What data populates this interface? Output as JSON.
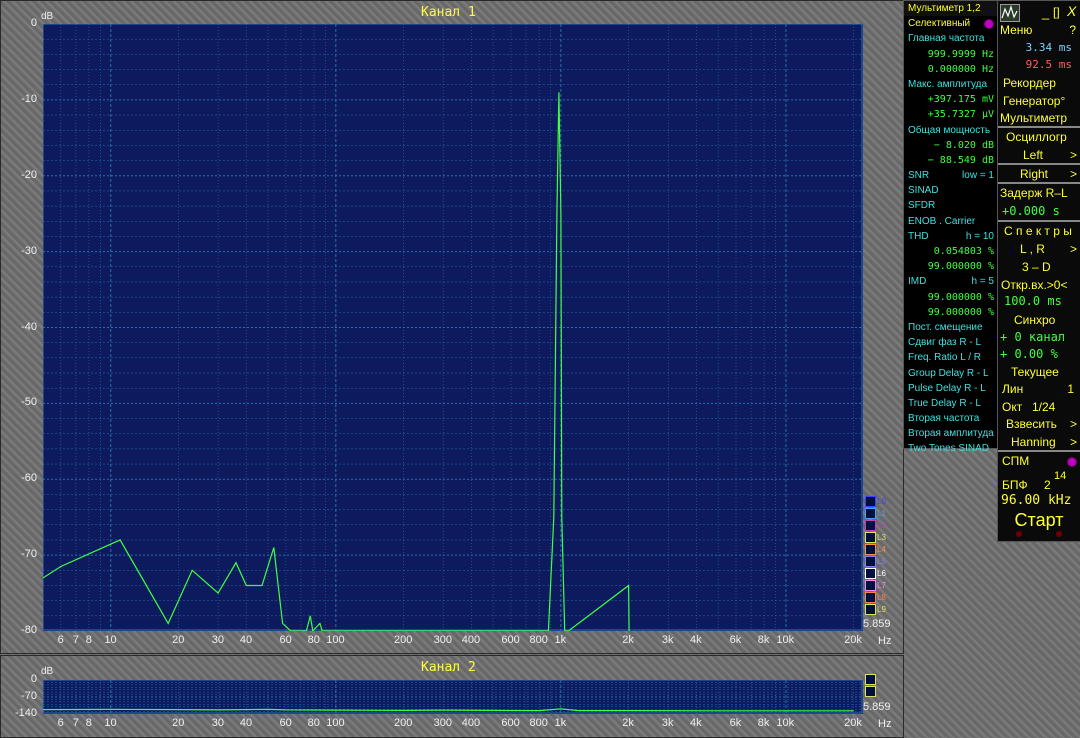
{
  "channel1": {
    "title": "Канал 1",
    "ylabel": "dB",
    "xunit": "Hz",
    "corner_value": "5.859",
    "y_ticks": [
      "0",
      "-10",
      "-20",
      "-30",
      "-40",
      "-50",
      "-60",
      "-70",
      "-80"
    ],
    "x_ticks": [
      "6",
      "7",
      "8",
      "10",
      "20",
      "30",
      "40",
      "60",
      "80",
      "100",
      "200",
      "300",
      "400",
      "600",
      "800",
      "1k",
      "2k",
      "3k",
      "4k",
      "6k",
      "8k",
      "10k",
      "20k"
    ],
    "legend": [
      "L0",
      "L1",
      "L2",
      "L3",
      "L4",
      "L5",
      "L6",
      "L7",
      "L8",
      "L9"
    ]
  },
  "channel2": {
    "title": "Канал 2",
    "ylabel": "dB",
    "xunit": "Hz",
    "corner_value": "5.859",
    "y_ticks": [
      "0",
      "-70",
      "-140"
    ],
    "x_ticks": [
      "6",
      "7",
      "8",
      "10",
      "20",
      "30",
      "40",
      "60",
      "80",
      "100",
      "200",
      "300",
      "400",
      "600",
      "800",
      "1k",
      "2k",
      "3k",
      "4k",
      "6k",
      "8k",
      "10k",
      "20k"
    ]
  },
  "chart_data": [
    {
      "type": "line",
      "title": "Канал 1",
      "xlabel": "Hz",
      "ylabel": "dB",
      "xscale": "log",
      "xlim": [
        5,
        22000
      ],
      "ylim": [
        -80,
        0
      ],
      "grid": true,
      "series": [
        {
          "color": "#40ff40",
          "x": [
            5,
            6,
            11,
            18,
            23,
            30,
            36,
            40,
            47,
            53,
            58,
            63,
            66,
            70,
            74,
            77,
            79,
            85,
            87,
            92,
            880,
            930,
            960,
            980,
            1000,
            1010,
            1040,
            1080,
            2000,
            2010
          ],
          "y": [
            -73,
            -71.5,
            -68,
            -79,
            -72,
            -75,
            -71,
            -74,
            -74,
            -69,
            -79,
            -80,
            -80,
            -80,
            -80,
            -78,
            -80,
            -79,
            -80,
            -80,
            -80,
            -65,
            -25,
            -9,
            -25,
            -65,
            -80,
            -80,
            -74,
            -80
          ]
        }
      ]
    },
    {
      "type": "line",
      "title": "Канал 2",
      "xlabel": "Hz",
      "ylabel": "dB",
      "xscale": "log",
      "xlim": [
        5,
        22000
      ],
      "ylim": [
        -140,
        0
      ],
      "grid": true,
      "series": [
        {
          "color": "#40ff40",
          "x": [
            5,
            10,
            20,
            30,
            40,
            50,
            60,
            100,
            200,
            300,
            500,
            800,
            1000,
            1200,
            2000,
            5000,
            10000,
            20000
          ],
          "y": [
            -122,
            -121,
            -122,
            -123,
            -122,
            -121,
            -123,
            -124,
            -125,
            -124,
            -125,
            -126,
            -119,
            -126,
            -126,
            -127,
            -127,
            -127
          ]
        }
      ]
    }
  ],
  "side_panel": {
    "title": "Мультиметр 1,2",
    "selective": "Селективный",
    "main_freq_label": "Главная частота",
    "main_freq_1": "999.9999  Hz",
    "main_freq_2": "0.000000  Hz",
    "max_amp_label": "Макс. амплитуда",
    "max_amp_1": "+397.175 mV",
    "max_amp_2": "+35.7327 µV",
    "total_power_label": "Общая мощность",
    "total_power_1": "−  8.020 dB",
    "total_power_2": "−  88.549 dB",
    "snr_label": "SNR",
    "snr_low": "low =  1",
    "sinad_label": "SINAD",
    "sfdr_label": "SFDR",
    "enob_label": "ENOB . Carrier",
    "thd_label": "THD",
    "thd_h": "h =  10",
    "thd_1": "0.054803 %",
    "thd_2": "99.000000 %",
    "imd_label": "IMD",
    "imd_h": "h =   5",
    "imd_1": "99.000000 %",
    "imd_2": "99.000000 %",
    "dc_offset": "Пост. смещение",
    "phase_shift": "Сдвиг фаз R - L",
    "freq_ratio": "Freq. Ratio  L / R",
    "group_delay": "Group Delay R - L",
    "pulse_delay": "Pulse Delay R - L",
    "true_delay": "True  Delay R - L",
    "second_freq": "Вторая частота",
    "second_amp": "Вторая амплитуда",
    "two_tones": "Two Tones SINAD"
  },
  "control_panel": {
    "minimize": "_",
    "restore": "[]",
    "close": "X",
    "menu": "Меню",
    "help": "?",
    "time_1": "3.34 ms",
    "time_2": "92.5 ms",
    "recorder": "Рекордер",
    "generator": "Генератор°",
    "multimeter": "Мультиметр",
    "oscilloscope": "Осциллогр",
    "left": "Left",
    "right": "Right",
    "arrow": ">",
    "delay_label": "Задерж  R–L",
    "delay_value": "+0.000  s",
    "spectra": "С п е к т р ы",
    "lr": "L , R",
    "three_d": "3 – D",
    "open_input": "Откр.вх.>0<",
    "open_input_value": "100.0 ms",
    "sync": "Синхро",
    "sync_channel": "+  0 канал",
    "sync_percent": "+  0.00 %",
    "current": "Текущее",
    "lin": "Лин",
    "lin_value": "1",
    "oct": "Окт",
    "oct_value": "1/24",
    "weigh": "Взвесить",
    "hanning": "Hanning",
    "spm": "СПМ",
    "fft_label": "БПФ",
    "fft_base": "2",
    "fft_exp": "14",
    "sample_rate": "96.00 kHz",
    "start": "Старт"
  },
  "colors": {
    "plot_bg": "#0d1b5e",
    "grid": "#2a6fb0",
    "trace": "#40ff40",
    "title": "#ffff40",
    "label_yellow": "#ffff30",
    "label_cyan": "#40e0e0",
    "value_green": "#40ff40",
    "time_red": "#ff6060"
  }
}
